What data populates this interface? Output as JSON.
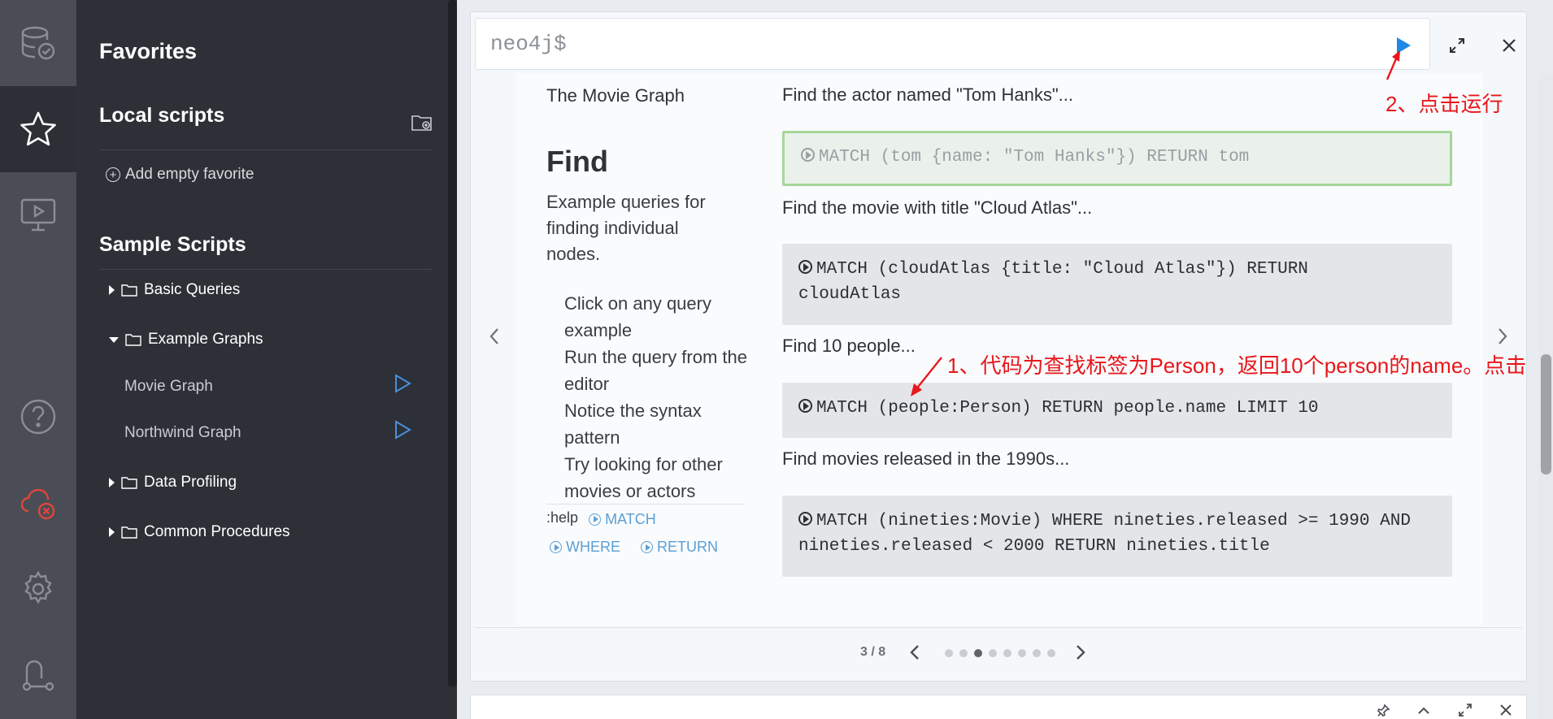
{
  "drawer": {
    "favorites_title": "Favorites",
    "local_scripts_title": "Local scripts",
    "add_empty_favorite": "Add empty favorite",
    "sample_scripts_title": "Sample Scripts",
    "folders": {
      "basic_queries": "Basic Queries",
      "example_graphs": "Example Graphs",
      "data_profiling": "Data Profiling",
      "common_procedures": "Common Procedures"
    },
    "scripts": {
      "movie_graph": "Movie Graph",
      "northwind_graph": "Northwind Graph"
    }
  },
  "editor": {
    "prompt": "neo4j$"
  },
  "guide": {
    "title": "The Movie Graph",
    "heading": "Find",
    "description": "Example queries for finding individual nodes.",
    "bullets": [
      "Click on any query example",
      "Run the query from the editor",
      "Notice the syntax pattern",
      "Try looking for other movies or actors"
    ],
    "help_label": ":help",
    "help_keywords": [
      "MATCH",
      "WHERE",
      "RETURN"
    ],
    "queries": [
      {
        "text": "Find the actor named \"Tom Hanks\"...",
        "code": "MATCH (tom {name: \"Tom Hanks\"}) RETURN tom"
      },
      {
        "text": "Find the movie with title \"Cloud Atlas\"...",
        "code_line1": "MATCH (cloudAtlas {title: \"Cloud Atlas\"}) RETURN",
        "code_line2": "cloudAtlas"
      },
      {
        "text": "Find 10 people...",
        "code": "MATCH (people:Person) RETURN people.name LIMIT 10"
      },
      {
        "text": "Find movies released in the 1990s...",
        "code_line1": "MATCH (nineties:Movie) WHERE nineties.released >= 1990 AND",
        "code_line2": "nineties.released < 2000 RETURN nineties.title"
      }
    ],
    "pager": {
      "count": "3 / 8",
      "total_pages": 8,
      "current_page": 3
    }
  },
  "annotations": {
    "step1": "1、代码为查找标签为Person，返回10个person的name。点击",
    "step2": "2、点击运行"
  },
  "colors": {
    "accent_blue": "#1e88e5",
    "annotation_red": "#e8171b",
    "rail_bg": "#4a4d55",
    "drawer_bg": "#2d3037",
    "error_icon": "#e0453a"
  }
}
